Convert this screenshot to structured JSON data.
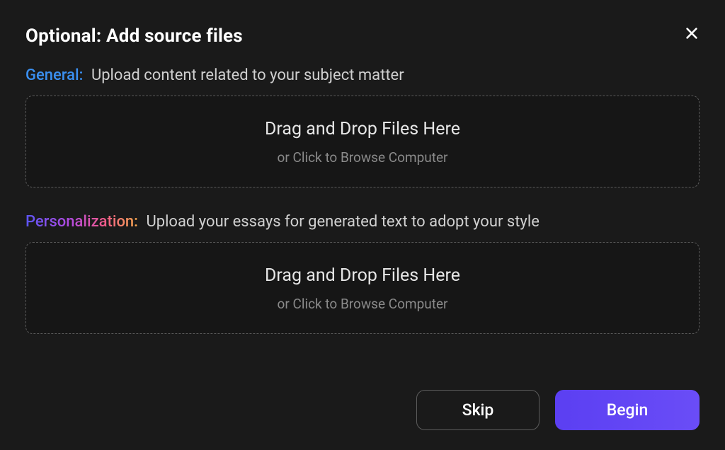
{
  "header": {
    "title": "Optional: Add source files"
  },
  "sections": {
    "general": {
      "label": "General:",
      "description": "Upload content related to your subject matter",
      "dropzone": {
        "title": "Drag and Drop Files Here",
        "subtitle": "or Click to Browse Computer"
      }
    },
    "personalization": {
      "label": "Personalization:",
      "description": "Upload your essays for generated text to adopt your style",
      "dropzone": {
        "title": "Drag and Drop Files Here",
        "subtitle": "or Click to Browse Computer"
      }
    }
  },
  "footer": {
    "skip": "Skip",
    "begin": "Begin"
  }
}
